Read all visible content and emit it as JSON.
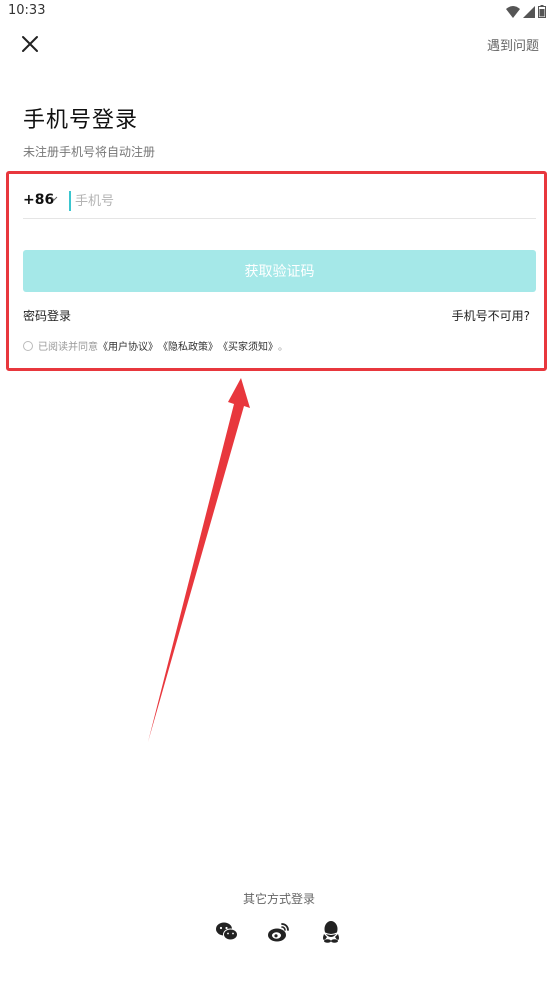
{
  "status": {
    "time": "10:33"
  },
  "header": {
    "help_label": "遇到问题"
  },
  "main": {
    "title": "手机号登录",
    "subtitle": "未注册手机号将自动注册",
    "country_code": "+86",
    "phone_placeholder": "手机号",
    "get_code_label": "获取验证码",
    "password_login_label": "密码登录",
    "phone_unavailable_label": "手机号不可用?",
    "agreement": {
      "prefix": "已阅读并同意",
      "user_agreement": "《用户协议》",
      "privacy_policy": "《隐私政策》",
      "buyer_notice": "《买家须知》",
      "suffix": "。"
    }
  },
  "footer": {
    "other_login_label": "其它方式登录",
    "social_icons": [
      "wechat-icon",
      "weibo-icon",
      "qq-icon"
    ]
  },
  "colors": {
    "accent": "#3bc6cf",
    "button_disabled": "#a5e8e8",
    "annotation_red": "#e8373d"
  }
}
